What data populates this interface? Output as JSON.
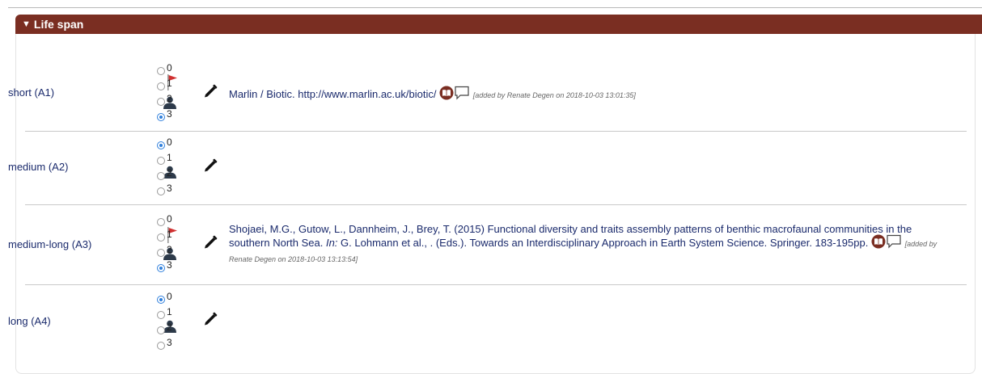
{
  "section": {
    "title": "Life span"
  },
  "rows": [
    {
      "label": "short (A1)",
      "selected": 3,
      "has_flag": true,
      "options": [
        "0",
        "1",
        "2",
        "3"
      ],
      "reference": {
        "text": "Marlin / Biotic. http://www.marlin.ac.uk/biotic/",
        "added": "[added by Renate Degen on 2018-10-03 13:01:35]"
      }
    },
    {
      "label": "medium (A2)",
      "selected": 0,
      "has_flag": false,
      "options": [
        "0",
        "1",
        "2",
        "3"
      ]
    },
    {
      "label": "medium-long (A3)",
      "selected": 3,
      "has_flag": true,
      "options": [
        "0",
        "1",
        "2",
        "3"
      ],
      "reference": {
        "part1": "Shojaei, M.G., Gutow, L., Dannheim, J., Brey, T. (2015) Functional diversity and traits assembly patterns of benthic macrofaunal communities in the southern North Sea. ",
        "in_label": "In:",
        "part2": " G. Lohmann et al., . (Eds.). Towards an Interdisciplinary Approach in Earth System Science. Springer. 183-195pp.",
        "added": "[added by Renate Degen on 2018-10-03 13:13:54]"
      }
    },
    {
      "label": "long (A4)",
      "selected": 0,
      "has_flag": false,
      "options": [
        "0",
        "1",
        "2",
        "3"
      ]
    }
  ],
  "colors": {
    "header_bg": "#7a2e22",
    "link": "#1a2a6c",
    "radio_selected": "#2f7fdc",
    "flag": "#d03030"
  },
  "icons": [
    "triangle-down-icon",
    "flag-icon",
    "person-icon",
    "pencil-icon",
    "book-icon",
    "comment-icon"
  ]
}
